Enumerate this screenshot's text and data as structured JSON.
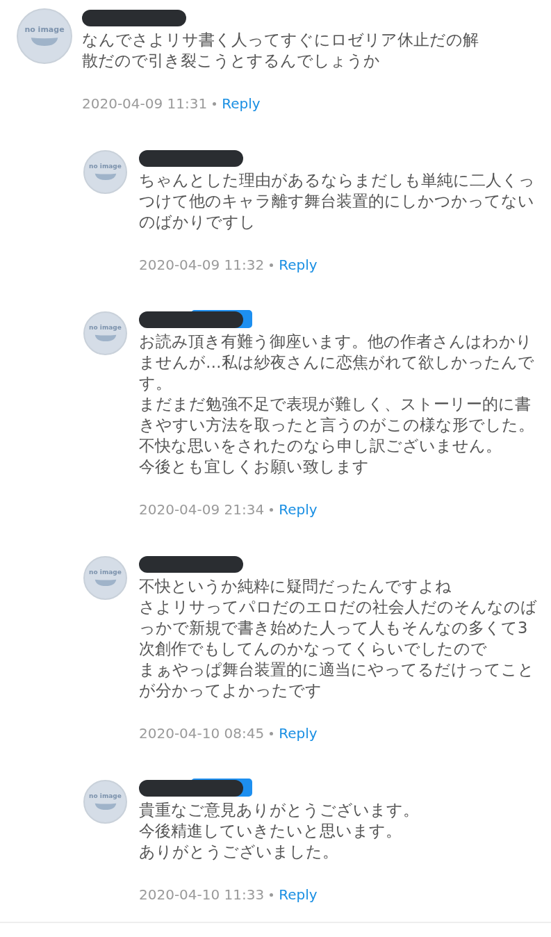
{
  "comments": [
    {
      "avatar_text": "no image",
      "badge": false,
      "paragraphs": [
        "なんでさよリサ書く人ってすぐにロゼリア休止だの解散だので引き裂こうとするんでしょうか"
      ],
      "time": "2020-04-09 11:31",
      "reply": "Reply",
      "replies": [
        {
          "avatar_text": "no image",
          "badge": false,
          "paragraphs": [
            "ちゃんとした理由があるならまだしも単純に二人くっつけて他のキャラ離す舞台装置的にしかつかってないのばかりですし"
          ],
          "time": "2020-04-09 11:32",
          "reply": "Reply"
        },
        {
          "avatar_text": "no image",
          "badge": true,
          "paragraphs": [
            "お読み頂き有難う御座います。他の作者さんはわかりませんが…私は紗夜さんに恋焦がれて欲しかったんです。",
            "まだまだ勉強不足で表現が難しく、ストーリー的に書きやすい方法を取ったと言うのがこの様な形でした。",
            "不快な思いをされたのなら申し訳ございません。",
            "今後とも宜しくお願い致します"
          ],
          "time": "2020-04-09 21:34",
          "reply": "Reply"
        },
        {
          "avatar_text": "no image",
          "badge": false,
          "paragraphs": [
            "不快というか純粋に疑問だったんですよね",
            "さよリサってパロだのエロだの社会人だのそんなのばっかで新規で書き始めた人って人もそんなの多くて3次創作でもしてんのかなってくらいでしたので",
            "まぁやっぱ舞台装置的に適当にやってるだけってことが分かってよかったです"
          ],
          "time": "2020-04-10 08:45",
          "reply": "Reply"
        },
        {
          "avatar_text": "no image",
          "badge": true,
          "paragraphs": [
            "貴重なご意見ありがとうございます。",
            "今後精進していきたいと思います。",
            "ありがとうございました。"
          ],
          "time": "2020-04-10 11:33",
          "reply": "Reply"
        }
      ]
    }
  ]
}
